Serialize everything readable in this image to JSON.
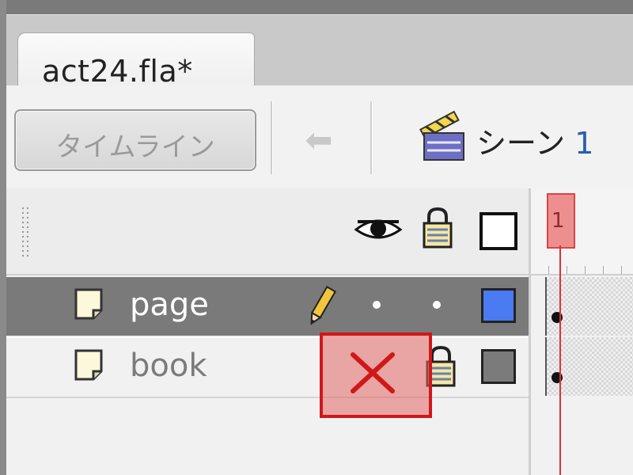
{
  "document_tab": {
    "title": "act24.fla*"
  },
  "toolbar": {
    "timeline_button_label": "タイムライン",
    "back_button_glyph": "⬅",
    "scene_label": "シーン",
    "scene_number": "1"
  },
  "layers_header": {
    "icons": [
      "eye-icon",
      "lock-icon",
      "outline-icon"
    ]
  },
  "layers": [
    {
      "name": "page",
      "selected": true,
      "editing_icon": "pencil-icon",
      "outline_color": "#4b7bf2"
    },
    {
      "name": "book",
      "selected": false,
      "locked": true,
      "outline_color": "#7b7b7b"
    }
  ],
  "timeline": {
    "current_frame": "1",
    "playhead_color": "#d33333"
  },
  "annotation": {
    "icon": "x-mark-icon",
    "color": "#d01818"
  }
}
